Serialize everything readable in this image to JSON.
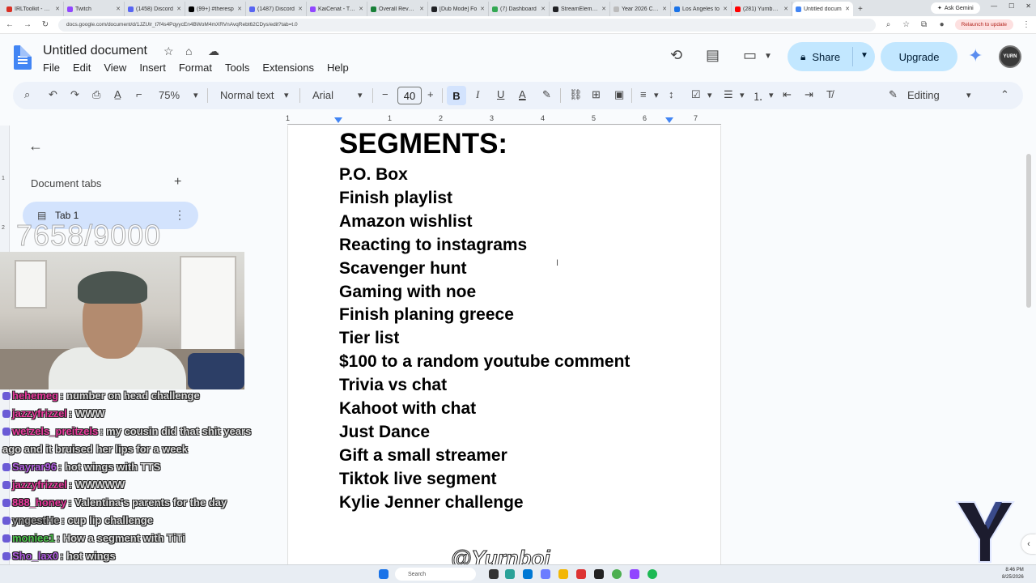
{
  "browser": {
    "tabs": [
      {
        "label": "IRLToolkit - Das",
        "color": "#d93025"
      },
      {
        "label": "Twitch",
        "color": "#9146ff"
      },
      {
        "label": "(1458) Discord",
        "color": "#5865f2"
      },
      {
        "label": "(99+) #theresp",
        "color": "#000000"
      },
      {
        "label": "(1487) Discord",
        "color": "#5865f2"
      },
      {
        "label": "KaiCenat - Twit",
        "color": "#9146ff"
      },
      {
        "label": "Overall Revenue",
        "color": "#188038"
      },
      {
        "label": "[Dub Mode] Fo",
        "color": "#202124"
      },
      {
        "label": "(7) Dashboard",
        "color": "#34a853"
      },
      {
        "label": "StreamElement",
        "color": "#202124"
      },
      {
        "label": "Year 2026 Cale",
        "color": "#bbbbbb"
      },
      {
        "label": "Los Angeles to",
        "color": "#1a73e8"
      },
      {
        "label": "(281) Yurnboi L",
        "color": "#ff0000"
      },
      {
        "label": "Untitled docum",
        "color": "#4285f4",
        "active": true
      }
    ],
    "new_tab": "+",
    "ask_gemini": "Ask Gemini",
    "url": "docs.google.com/document/d/1JZUlr_t7f4s4PqyycEn4BWoM4mXRVnAvqRebt62CDys/edit?tab=t.0",
    "relaunch": "Relaunch to update"
  },
  "docs": {
    "title": "Untitled document",
    "menu": [
      "File",
      "Edit",
      "View",
      "Insert",
      "Format",
      "Tools",
      "Extensions",
      "Help"
    ],
    "share_label": "Share",
    "upgrade_label": "Upgrade",
    "avatar_text": "YURN"
  },
  "toolbar": {
    "zoom": "75%",
    "style": "Normal text",
    "font": "Arial",
    "font_size": "40",
    "bold": "B",
    "italic": "I",
    "underline": "U",
    "text_color": "A",
    "editing_mode": "Editing"
  },
  "sidebar": {
    "heading": "Document tabs",
    "tab_name": "Tab 1"
  },
  "ruler": {
    "h_numbers": [
      "1",
      "1",
      "2",
      "3",
      "4",
      "5",
      "6",
      "7"
    ],
    "v_numbers": [
      "1",
      "2"
    ]
  },
  "document": {
    "heading": "SEGMENTS:",
    "items": [
      "P.O. Box",
      "Finish playlist",
      "Amazon wishlist",
      "Reacting to instagrams",
      "Scavenger hunt",
      "Gaming with noe",
      "Finish planing greece",
      "Tier list",
      "$100 to a random youtube comment",
      "Trivia vs chat",
      "Kahoot with chat",
      "Just Dance",
      "Gift a small streamer",
      "Tiktok live segment",
      "Kylie Jenner challenge"
    ]
  },
  "overlay": {
    "goal": "7658/9000",
    "watermark": "@Yurnboi",
    "chat": [
      {
        "user": "hehemeg",
        "color": "#e8389c",
        "text": "number on head challenge"
      },
      {
        "user": "jazzyfrizzel",
        "color": "#e8389c",
        "text": "WWW"
      },
      {
        "user": "wetzels_preitzels",
        "color": "#e8389c",
        "text": "my cousin did that shit years ago and it bruised her lips for a week"
      },
      {
        "user": "Sayrar96",
        "color": "#b05be0",
        "text": "hot wings with TTS"
      },
      {
        "user": "jazzyfrizzel",
        "color": "#e8389c",
        "text": "WWWWW"
      },
      {
        "user": "888_honey",
        "color": "#e8389c",
        "text": "Valentina's parents for the day"
      },
      {
        "user": "yngestHe",
        "color": "#9b9b9b",
        "text": "cup lip challenge"
      },
      {
        "user": "moniee1",
        "color": "#4bc44b",
        "text": "How a segment with TiTi"
      },
      {
        "user": "Sho_lax0",
        "color": "#b05be0",
        "text": "hot wings"
      }
    ]
  },
  "taskbar": {
    "search": "Search",
    "time": "8:46 PM",
    "date": "8/25/2026"
  }
}
